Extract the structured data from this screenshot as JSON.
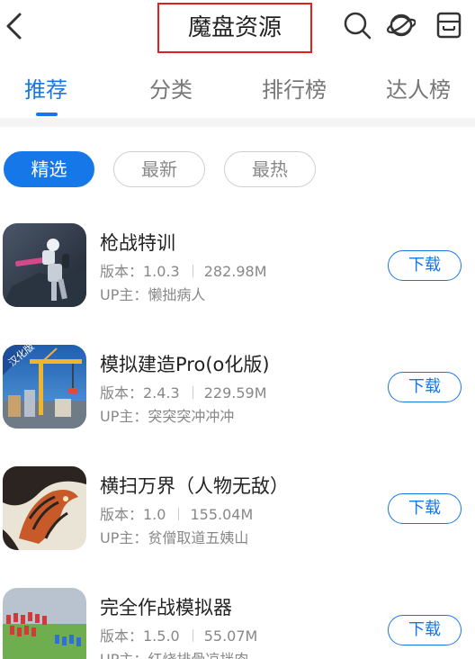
{
  "header": {
    "title": "魔盘资源",
    "icons": [
      "back-icon",
      "search-icon",
      "planet-icon",
      "box-icon"
    ]
  },
  "tabs": [
    {
      "label": "推荐",
      "active": true
    },
    {
      "label": "分类",
      "active": false
    },
    {
      "label": "排行榜",
      "active": false
    },
    {
      "label": "达人榜",
      "active": false
    }
  ],
  "chips": [
    {
      "label": "精选",
      "active": true
    },
    {
      "label": "最新",
      "active": false
    },
    {
      "label": "最热",
      "active": false
    }
  ],
  "apps": [
    {
      "name": "枪战特训",
      "version": "版本：1.0.3",
      "size": "282.98M",
      "uploader": "UP主：懒拙病人",
      "button": "下载"
    },
    {
      "name": "模拟建造Pro(o化版)",
      "version": "版本：2.4.3",
      "size": "229.59M",
      "uploader": "UP主：突突突冲冲冲",
      "button": "下载",
      "badge": "汉化版"
    },
    {
      "name": "横扫万界（人物无敌）",
      "version": "版本：1.0",
      "size": "155.04M",
      "uploader": "UP主：贫僧取道五姨山",
      "button": "下载"
    },
    {
      "name": "完全作战模拟器",
      "version": "版本：1.5.0",
      "size": "55.07M",
      "uploader": "UP主：红烧排骨凉拌肉",
      "button": "下载"
    }
  ],
  "colors": {
    "accent": "#1677e8",
    "highlight_box": "#e02020"
  }
}
